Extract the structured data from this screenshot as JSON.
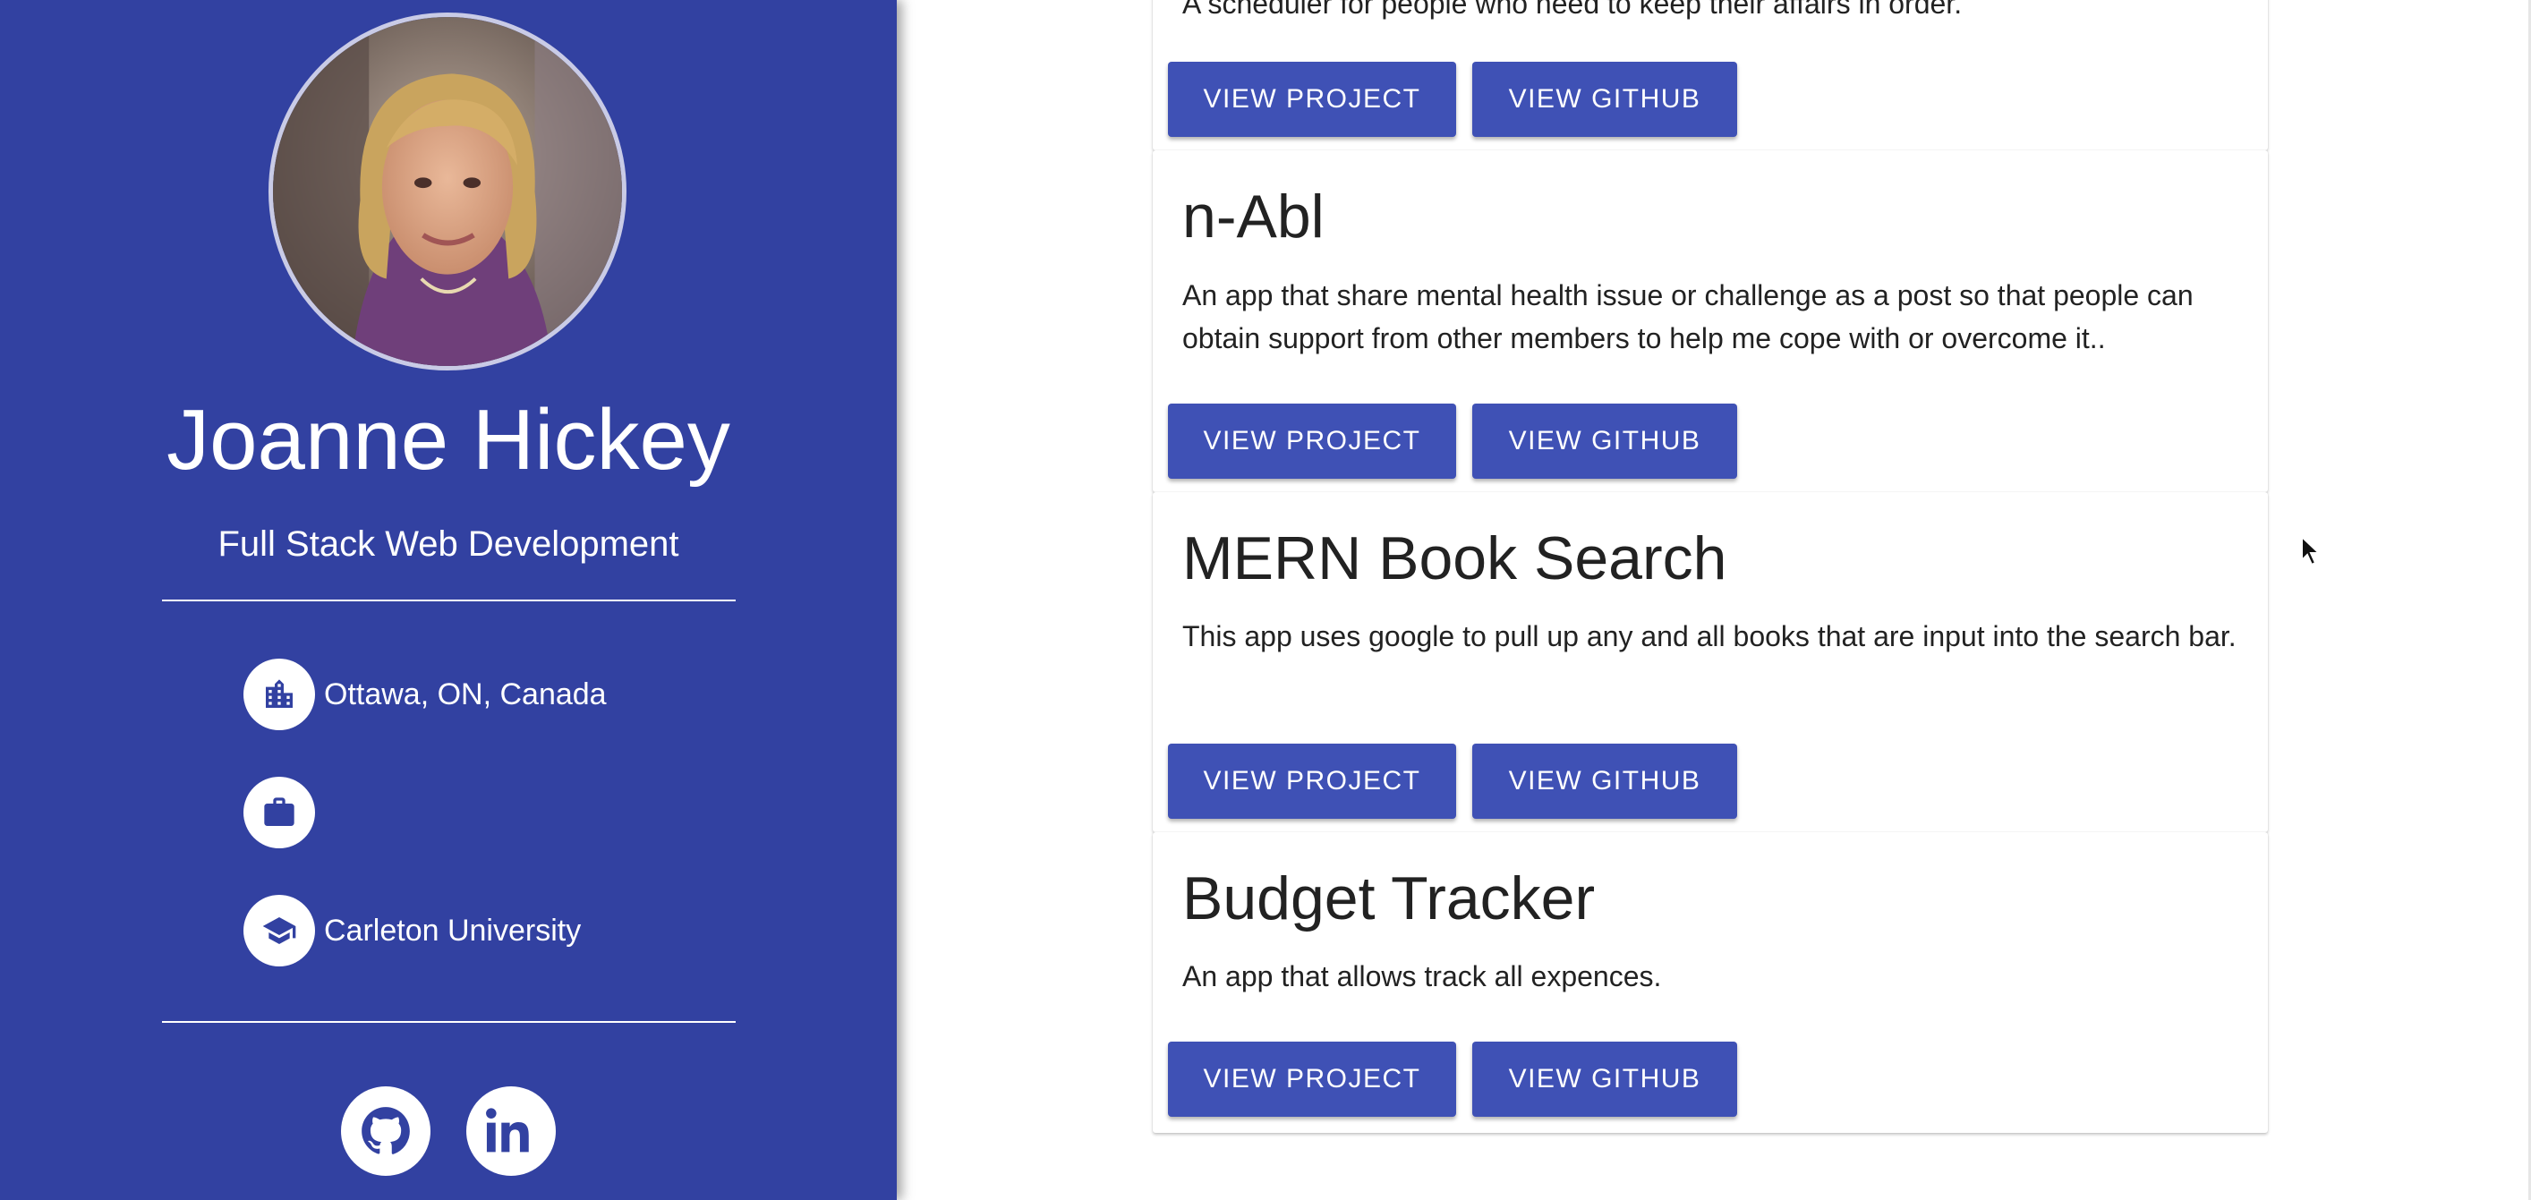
{
  "profile": {
    "name": "Joanne Hickey",
    "subtitle": "Full Stack Web Development",
    "location": "Ottawa, ON, Canada",
    "work": "",
    "education": "Carleton University",
    "icons": {
      "location": "city-icon",
      "work": "briefcase-icon",
      "education": "graduation-cap-icon",
      "github": "github-icon",
      "linkedin": "linkedin-icon"
    }
  },
  "projects": [
    {
      "title": "",
      "description": "A scheduler for people who need to keep their affairs in order.",
      "project_button": "VIEW PROJECT",
      "github_button": "VIEW GITHUB"
    },
    {
      "title": "n-Abl",
      "description": "An app that share mental health issue or challenge as a post so that people can obtain support from other members to help me cope with or overcome it..",
      "project_button": "VIEW PROJECT",
      "github_button": "VIEW GITHUB"
    },
    {
      "title": "MERN Book Search",
      "description": "This app uses google to pull up any and all books that are input into the search bar.",
      "project_button": "VIEW PROJECT",
      "github_button": "VIEW GITHUB"
    },
    {
      "title": "Budget Tracker",
      "description": "An app that allows track all expences.",
      "project_button": "VIEW PROJECT",
      "github_button": "VIEW GITHUB"
    }
  ],
  "colors": {
    "sidebar": "#3241a1",
    "button": "#3f51b5",
    "text": "#222222"
  }
}
